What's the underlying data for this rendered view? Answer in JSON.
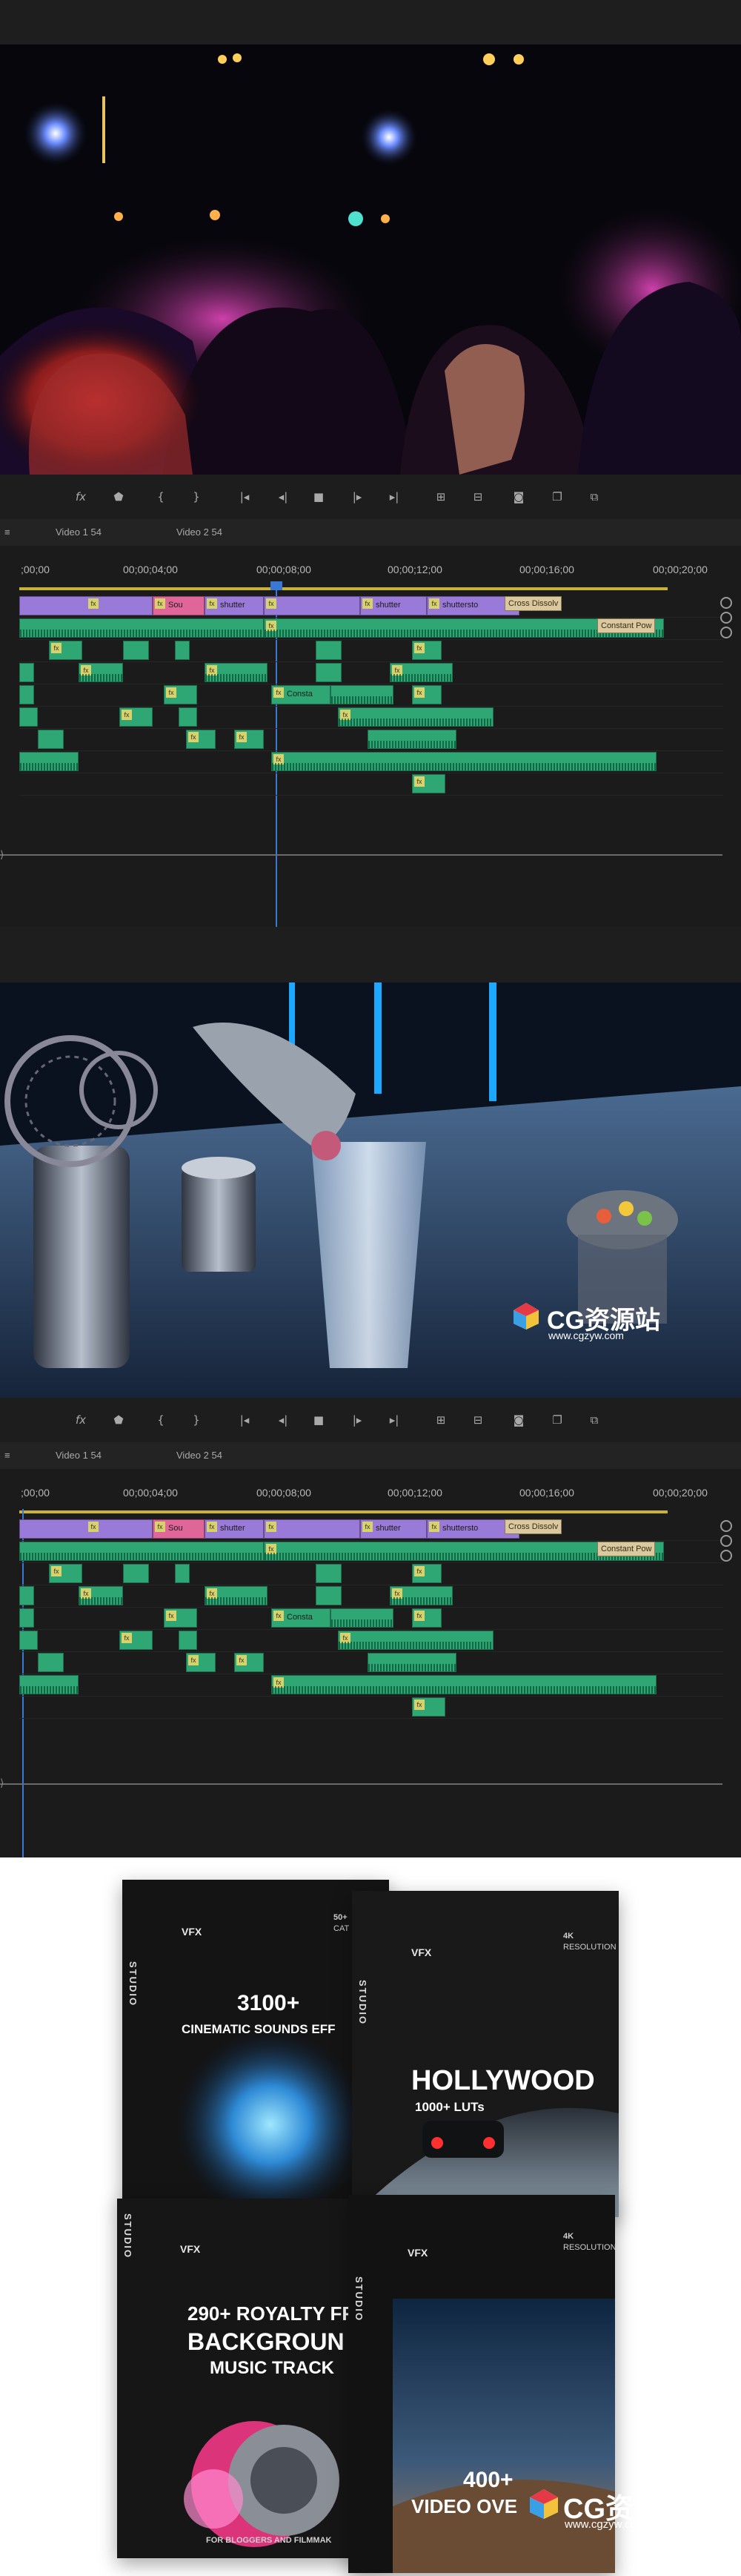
{
  "monitor1": {
    "controls": [
      "fx",
      "marker",
      "{",
      "}",
      "go-to-in",
      "step-back",
      "stop",
      "play",
      "go-to-out",
      "insert",
      "overwrite",
      "export-frame",
      "compare",
      "multi"
    ]
  },
  "timeline": {
    "tabs": [
      "Video 1 54",
      "Video 2 54"
    ],
    "ticks": [
      ";00;00",
      "00;00;04;00",
      "00;00;08;00",
      "00;00;12;00",
      "00;00;16;00",
      "00;00;20;00"
    ],
    "clip_labels": {
      "sou": "Sou",
      "shutter1": "shutter",
      "shutter2": "shutter",
      "shuttersto": "shuttersto",
      "cross": "Cross Dissolv",
      "constant": "Constant Pow",
      "const2": "Consta"
    },
    "fx_label": "fx"
  },
  "watermark": {
    "text": "CG资源站",
    "url": "www.cgzyw.com"
  },
  "products": {
    "box1": {
      "brand": "VFX",
      "studio": "STUDIO",
      "title": "3100+",
      "subtitle": "CINEMATIC SOUNDS EFF",
      "badge_num": "50+",
      "badge_txt": "CAT"
    },
    "box2": {
      "brand": "VFX",
      "studio": "STUDIO",
      "title": "HOLLYWOOD",
      "subtitle": "1000+ LUTs",
      "badge_num": "4K",
      "badge_txt": "RESOLUTION"
    },
    "box3": {
      "brand": "VFX",
      "studio": "STUDIO",
      "title1": "290+ ROYALTY FR",
      "title2": "BACKGROUN",
      "title3": "MUSIC TRACK",
      "footer": "FOR BLOGGERS AND FILMMAK"
    },
    "box4": {
      "brand": "VFX",
      "studio": "STUDIO",
      "title1": "400+",
      "title2": "VIDEO OVE",
      "badge_num": "4K",
      "badge_txt": "RESOLUTION"
    }
  },
  "colors": {
    "video_clip": "#9a7ad8",
    "audio_clip": "#2ea774",
    "pink_clip": "#e0669a",
    "playhead": "#3a78d6"
  }
}
